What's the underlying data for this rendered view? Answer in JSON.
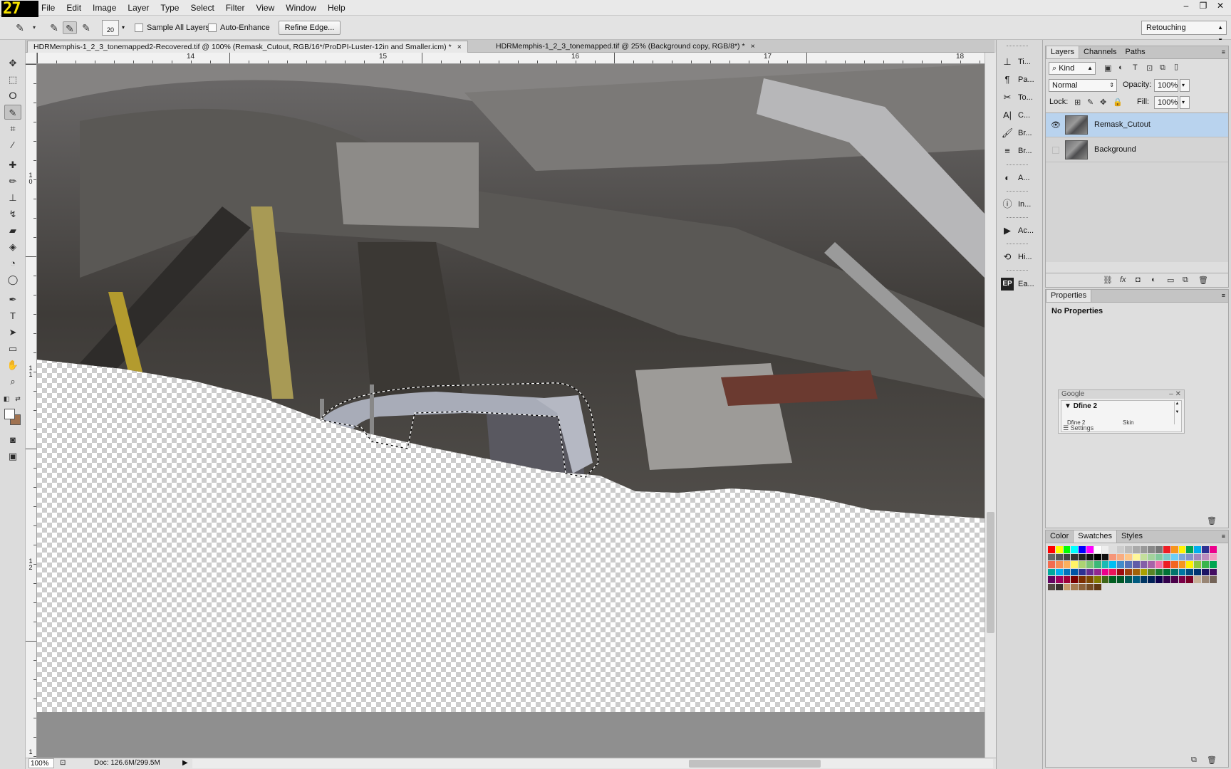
{
  "overlay": {
    "fps": "27"
  },
  "menubar": {
    "items": [
      "File",
      "Edit",
      "Image",
      "Layer",
      "Type",
      "Select",
      "Filter",
      "View",
      "Window",
      "Help"
    ],
    "window_controls": [
      "–",
      "❐",
      "✕"
    ]
  },
  "options": {
    "brush_size": "20",
    "sample_all_layers": "Sample All Layers",
    "auto_enhance": "Auto-Enhance",
    "refine_edge": "Refine Edge...",
    "workspace": "Retouching"
  },
  "tabs": [
    {
      "label": "HDRMemphis-1_2_3_tonemapped2-Recovered.tif @ 100% (Remask_Cutout, RGB/16*/ProDPI-Luster-12in and Smaller.icm) *",
      "close": "×"
    },
    {
      "label": "HDRMemphis-1_2_3_tonemapped.tif @ 25% (Background copy, RGB/8*) *",
      "close": "×"
    }
  ],
  "ruler": {
    "h_labels": [
      "14",
      "15",
      "16",
      "17",
      "18"
    ],
    "v_labels": [
      "1 0",
      "1 1",
      "1 2",
      "1"
    ]
  },
  "status": {
    "zoom": "100%",
    "doc": "Doc: 126.6M/299.5M"
  },
  "iconpanel": {
    "items": [
      {
        "icon": "type-tool-icon",
        "glyph": "⊥",
        "label": "Ti..."
      },
      {
        "icon": "paragraph-icon",
        "glyph": "¶",
        "label": "Pa..."
      },
      {
        "icon": "tool-presets-icon",
        "glyph": "✂",
        "label": "To..."
      },
      {
        "icon": "character-icon",
        "glyph": "A|",
        "label": "C..."
      },
      {
        "icon": "brush-icon",
        "glyph": "🖌",
        "label": "Br..."
      },
      {
        "icon": "brush-presets-icon",
        "glyph": "≡",
        "label": "Br..."
      },
      {
        "icon": "adjustments-icon",
        "glyph": "◐",
        "label": "A..."
      },
      {
        "icon": "info-icon",
        "glyph": "ⓘ",
        "label": "In..."
      },
      {
        "icon": "actions-icon",
        "glyph": "▶",
        "label": "Ac..."
      },
      {
        "icon": "history-icon",
        "glyph": "⟲",
        "label": "Hi..."
      },
      {
        "icon": "easy-panel-icon",
        "glyph": "EP",
        "label": "Ea..."
      }
    ]
  },
  "layers_panel": {
    "tabs": [
      "Layers",
      "Channels",
      "Paths"
    ],
    "kind": "Kind",
    "blend_mode": "Normal",
    "opacity_label": "Opacity:",
    "opacity": "100%",
    "lock_label": "Lock:",
    "fill_label": "Fill:",
    "fill": "100%",
    "layers": [
      {
        "name": "Remask_Cutout",
        "visible": true,
        "selected": true
      },
      {
        "name": "Background",
        "visible": false,
        "selected": false
      }
    ],
    "footer_icons": [
      "link-icon",
      "fx-icon",
      "mask-icon",
      "adjustment-layer-icon",
      "group-icon",
      "new-layer-icon",
      "trash-icon"
    ]
  },
  "properties_panel": {
    "tab": "Properties",
    "content": "No Properties"
  },
  "google_panel": {
    "title": "Google",
    "tree": "Dfine 2",
    "row_a": "Dfine 2",
    "row_b": "Skin",
    "settings": "Settings"
  },
  "swatch_panel": {
    "tabs": [
      "Color",
      "Swatches",
      "Styles"
    ],
    "swatches": [
      "#ff0000",
      "#ffff00",
      "#00ff00",
      "#00ffff",
      "#0000ff",
      "#ff00ff",
      "#ffffff",
      "#eeeeee",
      "#dddddd",
      "#cccccc",
      "#bbbbbb",
      "#aaaaaa",
      "#999999",
      "#888888",
      "#777777",
      "#ee1d24",
      "#f7941d",
      "#fff200",
      "#00a651",
      "#00aeef",
      "#2e3192",
      "#ec008c",
      "#666666",
      "#555555",
      "#444444",
      "#333333",
      "#222222",
      "#111111",
      "#000000",
      "#111111",
      "#f69679",
      "#f9ad81",
      "#fdc689",
      "#fff799",
      "#c4df9b",
      "#a3d39c",
      "#82ca9c",
      "#7accc8",
      "#6dcff6",
      "#7da7d9",
      "#8393ca",
      "#a187be",
      "#bc8cbf",
      "#f49ac2",
      "#f26c4f",
      "#f68e55",
      "#fbaf5c",
      "#fff467",
      "#acd373",
      "#7cc576",
      "#3bb878",
      "#1abbb4",
      "#00bff3",
      "#438ccb",
      "#5674b9",
      "#605ca8",
      "#855fa8",
      "#a763a8",
      "#f06ea9",
      "#ed1c24",
      "#f26522",
      "#f7941d",
      "#fff200",
      "#8dc73f",
      "#39b54a",
      "#00a651",
      "#00a99d",
      "#00aeef",
      "#0072bc",
      "#0054a6",
      "#2e3192",
      "#662d91",
      "#92278f",
      "#ec008c",
      "#ed145b",
      "#9e0b0f",
      "#a0410d",
      "#a36209",
      "#aba000",
      "#598527",
      "#197b30",
      "#007236",
      "#00746b",
      "#0076a3",
      "#004a80",
      "#003471",
      "#1b1464",
      "#440e62",
      "#630460",
      "#9e005d",
      "#9e0039",
      "#790000",
      "#7b2e00",
      "#7d4900",
      "#827b00",
      "#406618",
      "#005e20",
      "#005826",
      "#005952",
      "#005b7f",
      "#003663",
      "#002157",
      "#0d004c",
      "#32004b",
      "#4b0049",
      "#7b0046",
      "#7a0026",
      "#c7b299",
      "#998675",
      "#736357",
      "#534741",
      "#37302d",
      "#c69c6d",
      "#a67c52",
      "#8c6239",
      "#754c24",
      "#603913"
    ]
  }
}
